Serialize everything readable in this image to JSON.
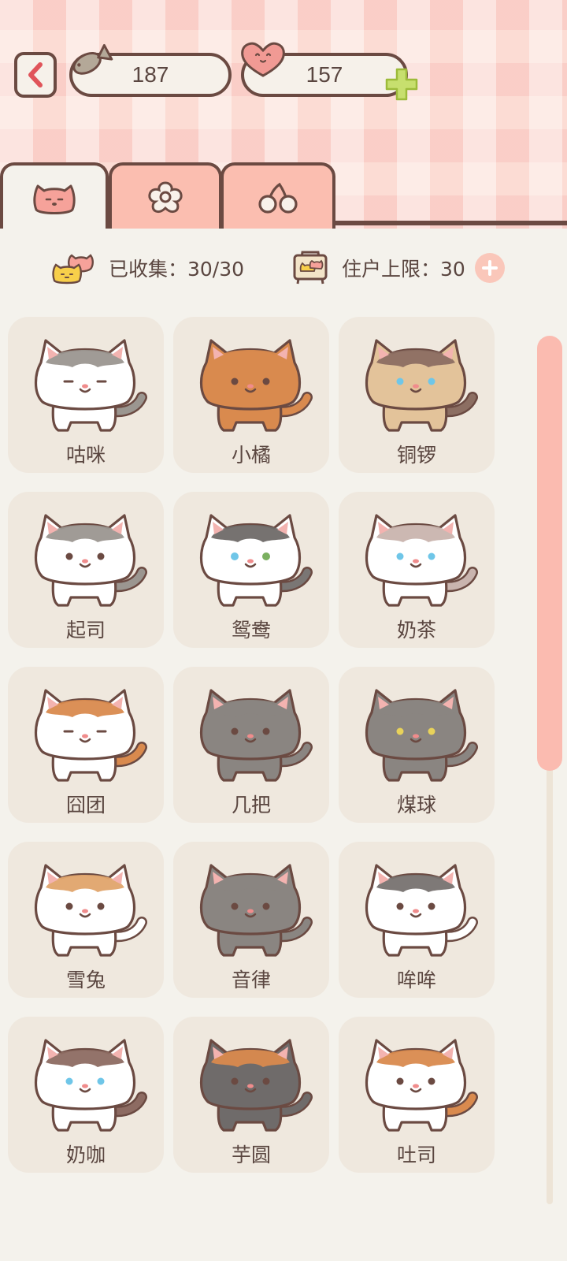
{
  "header": {
    "back_icon": "chevron-left-icon",
    "fish_count": "187",
    "heart_count": "157"
  },
  "tabs": [
    {
      "icon": "cat-face-icon",
      "active": true
    },
    {
      "icon": "flower-icon",
      "active": false
    },
    {
      "icon": "cherry-icon",
      "active": false
    }
  ],
  "stats": {
    "collected_label": "已收集：30/30",
    "limit_label": "住户上限：30"
  },
  "cats": [
    {
      "name": "咕咪",
      "body": "#ffffff",
      "head": "#ffffff",
      "patch": "#9b9690",
      "tail": "#9b9690",
      "ears": "#9b9690",
      "eyes": "line"
    },
    {
      "name": "小橘",
      "body": "#d98a4e",
      "head": "#d98a4e",
      "patch": "#d98a4e",
      "tail": "#d98a4e",
      "ears": "#d98a4e",
      "eyes": "dot"
    },
    {
      "name": "铜锣",
      "body": "#e3c39a",
      "head": "#e3c39a",
      "patch": "#8c6e62",
      "tail": "#8c6e62",
      "ears": "#8c6e62",
      "eyes": "blue"
    },
    {
      "name": "起司",
      "body": "#ffffff",
      "head": "#ffffff",
      "patch": "#9b9690",
      "tail": "#9b9690",
      "ears": "#9b9690",
      "eyes": "dot"
    },
    {
      "name": "鸳鸯",
      "body": "#ffffff",
      "head": "#ffffff",
      "patch": "#6f6a68",
      "tail": "#7a7674",
      "ears": "#6f6a68",
      "eyes": "odd"
    },
    {
      "name": "奶茶",
      "body": "#ffffff",
      "head": "#ffffff",
      "patch": "#c9b4ae",
      "tail": "#c9b4ae",
      "ears": "#c9b4ae",
      "eyes": "blue"
    },
    {
      "name": "囧团",
      "body": "#ffffff",
      "head": "#ffffff",
      "patch": "#d98a4e",
      "tail": "#d98a4e",
      "ears": "#d98a4e",
      "eyes": "line"
    },
    {
      "name": "几把",
      "body": "#8a8581",
      "head": "#8a8581",
      "patch": "#8a8581",
      "tail": "#8a8581",
      "ears": "#8a8581",
      "eyes": "dot"
    },
    {
      "name": "煤球",
      "body": "#8a8581",
      "head": "#8a8581",
      "patch": "#8a8581",
      "tail": "#8a8581",
      "ears": "#8a8581",
      "eyes": "yellow"
    },
    {
      "name": "雪兔",
      "body": "#ffffff",
      "head": "#ffffff",
      "patch": "#e0a46c",
      "tail": "#ffffff",
      "ears": "#ffffff",
      "eyes": "dot"
    },
    {
      "name": "音律",
      "body": "#8a8581",
      "head": "#8a8581",
      "patch": "#8a8581",
      "tail": "#8a8581",
      "ears": "#8a8581",
      "eyes": "dot"
    },
    {
      "name": "哞哞",
      "body": "#ffffff",
      "head": "#ffffff",
      "patch": "#777270",
      "tail": "#ffffff",
      "ears": "#777270",
      "eyes": "dot"
    },
    {
      "name": "奶咖",
      "body": "#ffffff",
      "head": "#ffffff",
      "patch": "#8d6b62",
      "tail": "#8d6b62",
      "ears": "#8d6b62",
      "eyes": "blue"
    },
    {
      "name": "芋圆",
      "body": "#6f6b6a",
      "head": "#6f6b6a",
      "patch": "#d98a4e",
      "tail": "#6f6b6a",
      "ears": "#d98a4e",
      "eyes": "dot"
    },
    {
      "name": "吐司",
      "body": "#ffffff",
      "head": "#ffffff",
      "patch": "#d98a4e",
      "tail": "#d98a4e",
      "ears": "#d98a4e",
      "eyes": "dot"
    }
  ]
}
